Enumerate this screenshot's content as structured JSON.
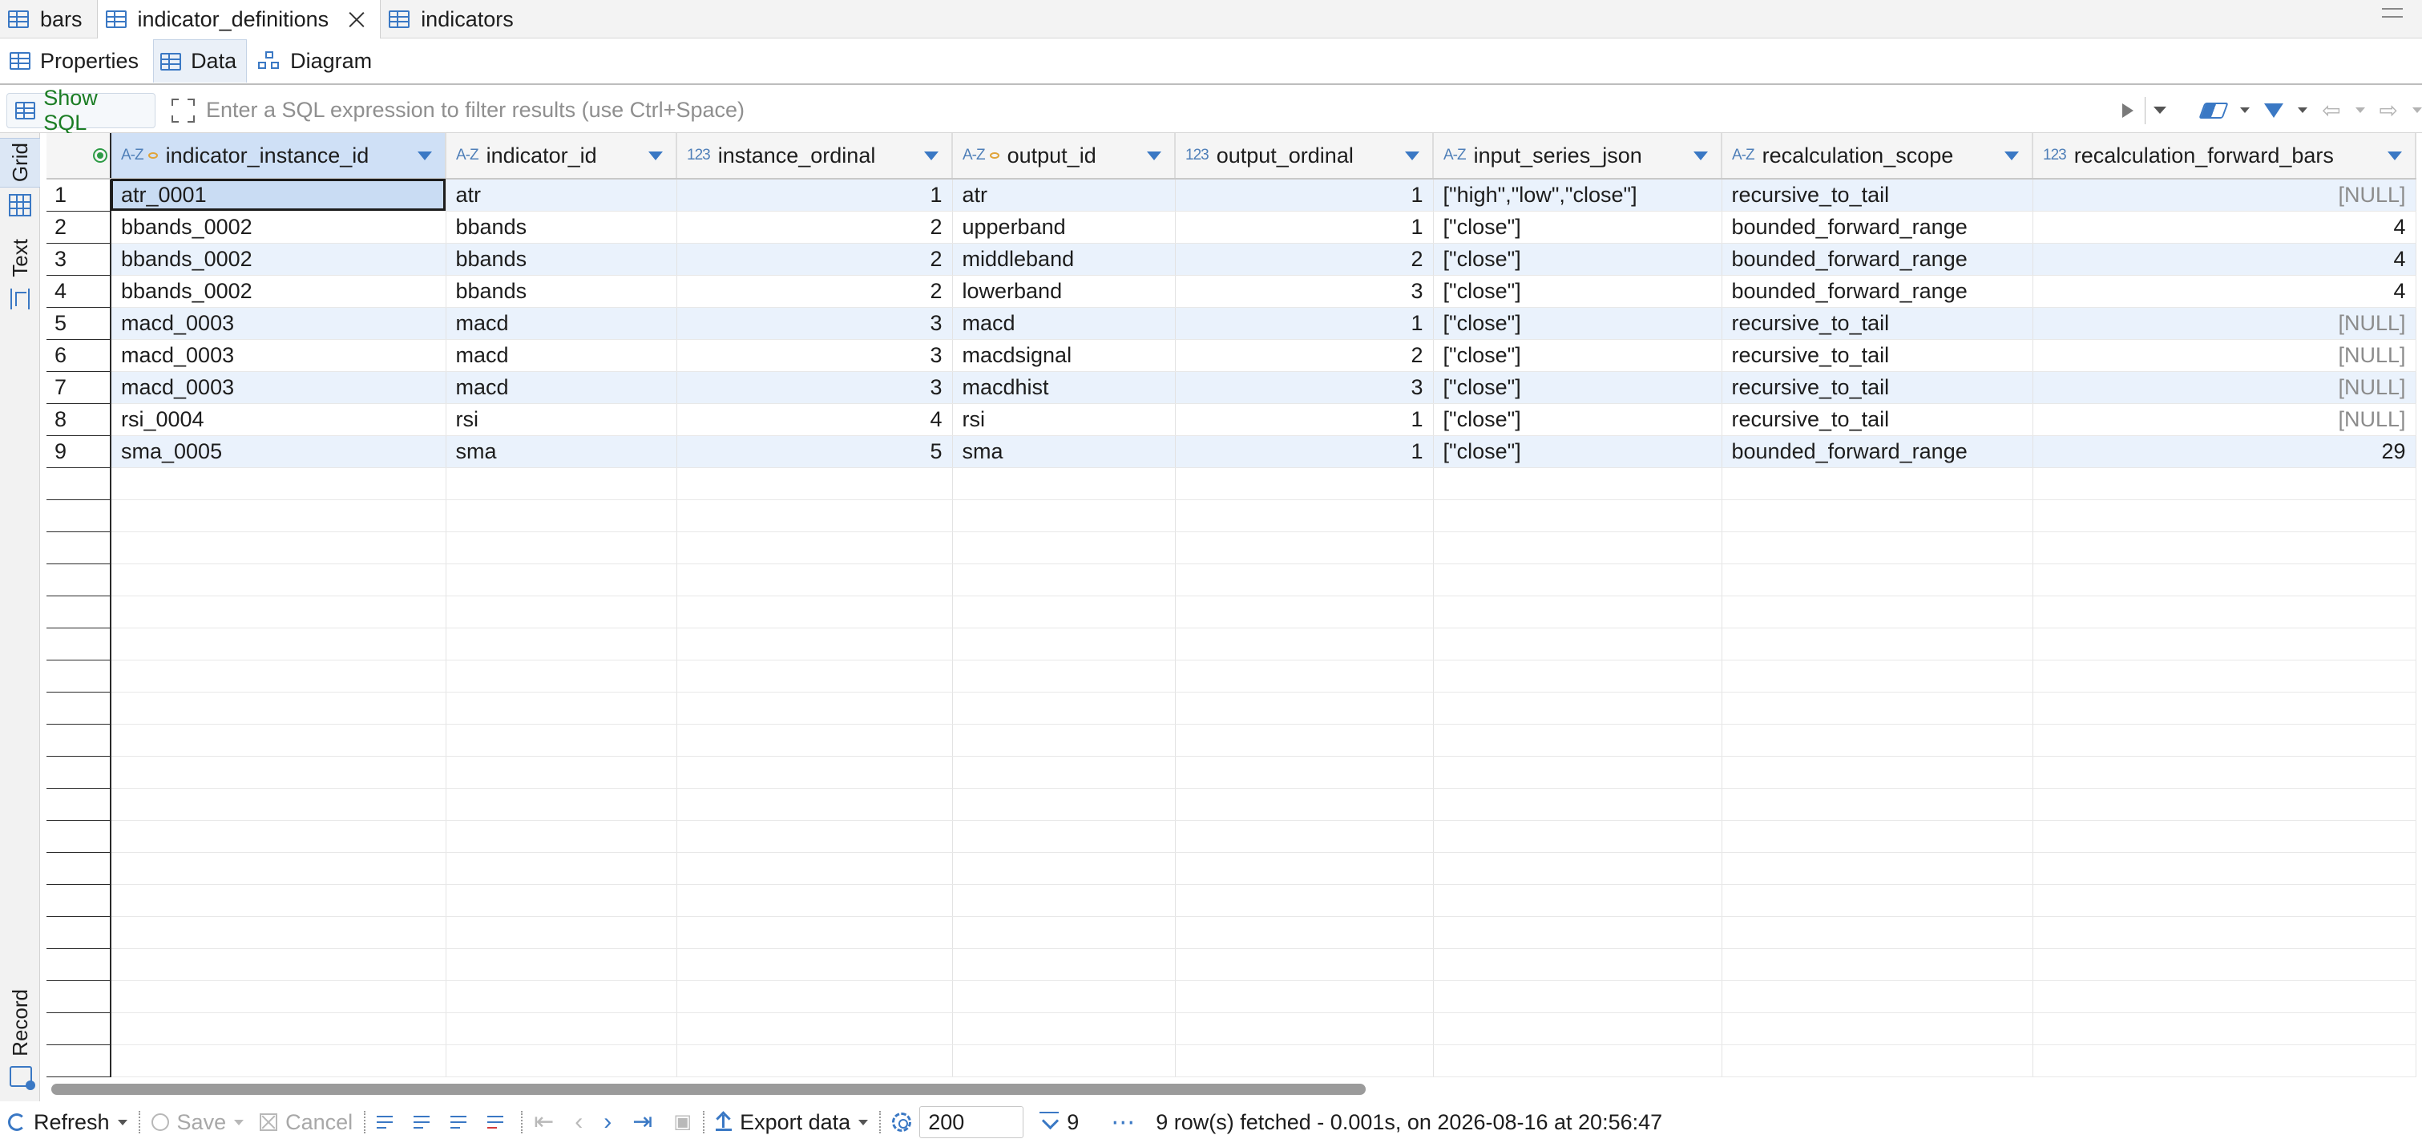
{
  "editor_tabs": [
    {
      "label": "bars",
      "active": false
    },
    {
      "label": "indicator_definitions",
      "active": true
    },
    {
      "label": "indicators",
      "active": false
    }
  ],
  "sub_tabs": [
    {
      "label": "Properties",
      "active": false
    },
    {
      "label": "Data",
      "active": true
    },
    {
      "label": "Diagram",
      "active": false
    }
  ],
  "filter": {
    "show_sql_label": "Show SQL",
    "placeholder": "Enter a SQL expression to filter results (use Ctrl+Space)",
    "value": ""
  },
  "side_tabs": {
    "grid": "Grid",
    "text": "Text",
    "record": "Record"
  },
  "grid": {
    "columns": [
      {
        "name": "indicator_instance_id",
        "type_badge": "A-Z",
        "key": true
      },
      {
        "name": "indicator_id",
        "type_badge": "A-Z",
        "key": false
      },
      {
        "name": "instance_ordinal",
        "type_badge": "123",
        "key": false
      },
      {
        "name": "output_id",
        "type_badge": "A-Z",
        "key": true
      },
      {
        "name": "output_ordinal",
        "type_badge": "123",
        "key": false
      },
      {
        "name": "input_series_json",
        "type_badge": "A-Z",
        "key": false
      },
      {
        "name": "recalculation_scope",
        "type_badge": "A-Z",
        "key": false
      },
      {
        "name": "recalculation_forward_bars",
        "type_badge": "123",
        "key": false
      }
    ],
    "rows": [
      {
        "num": "1",
        "cells": [
          "atr_0001",
          "atr",
          "1",
          "atr",
          "1",
          "[\"high\",\"low\",\"close\"]",
          "recursive_to_tail",
          "[NULL]"
        ]
      },
      {
        "num": "2",
        "cells": [
          "bbands_0002",
          "bbands",
          "2",
          "upperband",
          "1",
          "[\"close\"]",
          "bounded_forward_range",
          "4"
        ]
      },
      {
        "num": "3",
        "cells": [
          "bbands_0002",
          "bbands",
          "2",
          "middleband",
          "2",
          "[\"close\"]",
          "bounded_forward_range",
          "4"
        ]
      },
      {
        "num": "4",
        "cells": [
          "bbands_0002",
          "bbands",
          "2",
          "lowerband",
          "3",
          "[\"close\"]",
          "bounded_forward_range",
          "4"
        ]
      },
      {
        "num": "5",
        "cells": [
          "macd_0003",
          "macd",
          "3",
          "macd",
          "1",
          "[\"close\"]",
          "recursive_to_tail",
          "[NULL]"
        ]
      },
      {
        "num": "6",
        "cells": [
          "macd_0003",
          "macd",
          "3",
          "macdsignal",
          "2",
          "[\"close\"]",
          "recursive_to_tail",
          "[NULL]"
        ]
      },
      {
        "num": "7",
        "cells": [
          "macd_0003",
          "macd",
          "3",
          "macdhist",
          "3",
          "[\"close\"]",
          "recursive_to_tail",
          "[NULL]"
        ]
      },
      {
        "num": "8",
        "cells": [
          "rsi_0004",
          "rsi",
          "4",
          "rsi",
          "1",
          "[\"close\"]",
          "recursive_to_tail",
          "[NULL]"
        ]
      },
      {
        "num": "9",
        "cells": [
          "sma_0005",
          "sma",
          "5",
          "sma",
          "1",
          "[\"close\"]",
          "bounded_forward_range",
          "29"
        ]
      }
    ]
  },
  "bottom_bar": {
    "refresh_label": "Refresh",
    "save_label": "Save",
    "cancel_label": "Cancel",
    "export_label": "Export data",
    "fetch_size": "200",
    "row_count": "9",
    "status": "9 row(s) fetched - 0.001s, on 2026-08-16 at 20:56:47"
  },
  "colors": {
    "accent": "#3a78c4",
    "selected_row": "#eaf2fc",
    "show_sql_text": "#1b7d24",
    "null_text": "#8c8c8c"
  }
}
